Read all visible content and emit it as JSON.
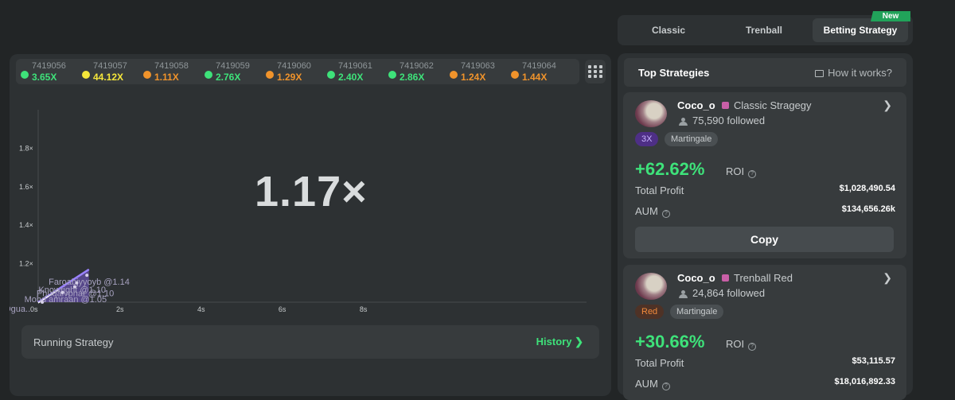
{
  "crash_history": [
    {
      "id": "7419056",
      "multiplier": "3.65X",
      "color": "#3ee27a"
    },
    {
      "id": "7419057",
      "multiplier": "44.12X",
      "color": "#f5e63a"
    },
    {
      "id": "7419058",
      "multiplier": "1.11X",
      "color": "#f0932b"
    },
    {
      "id": "7419059",
      "multiplier": "2.76X",
      "color": "#3ee27a"
    },
    {
      "id": "7419060",
      "multiplier": "1.29X",
      "color": "#f0932b"
    },
    {
      "id": "7419061",
      "multiplier": "2.40X",
      "color": "#3ee27a"
    },
    {
      "id": "7419062",
      "multiplier": "2.86X",
      "color": "#3ee27a"
    },
    {
      "id": "7419063",
      "multiplier": "1.24X",
      "color": "#f0932b"
    },
    {
      "id": "7419064",
      "multiplier": "1.44X",
      "color": "#f0932b"
    }
  ],
  "current_multiplier": "1.17×",
  "chart_data": {
    "type": "line",
    "x_ticks": [
      "0s",
      "2s",
      "4s",
      "6s",
      "8s"
    ],
    "y_ticks": [
      "1.2×",
      "1.4×",
      "1.6×",
      "1.8×"
    ],
    "xlim": [
      0,
      10
    ],
    "ylim": [
      1.0,
      2.0
    ],
    "curve": {
      "x": [
        0,
        1.25
      ],
      "y": [
        1.0,
        1.17
      ]
    },
    "cashouts": [
      {
        "label": "Faroabjyyoyb @1.14",
        "x": 1.2,
        "y": 1.14
      },
      {
        "label": "Knowright @1.10",
        "x": 0.95,
        "y": 1.1
      },
      {
        "label": "Phuqaivphar @1.10",
        "x": 0.9,
        "y": 1.08
      },
      {
        "label": "Mohd amraan @1.05",
        "x": 0.6,
        "y": 1.05
      },
      {
        "label": "Ogua...",
        "x": 0.1,
        "y": 1.0
      }
    ]
  },
  "running": {
    "label": "Running Strategy",
    "history_label": "History"
  },
  "tabs": [
    {
      "label": "Classic"
    },
    {
      "label": "Trenball"
    },
    {
      "label": "Betting Strategy",
      "active": true
    }
  ],
  "new_badge": "New",
  "top_strategies": {
    "title": "Top Strategies",
    "how_label": "How it works?"
  },
  "strategies": [
    {
      "user": "Coco_o",
      "type": "Classic Stragegy",
      "followed": "75,590 followed",
      "tags": [
        {
          "label": "3X",
          "bg": "#4e2f86",
          "color": "#c9b4ff"
        },
        {
          "label": "Martingale",
          "bg": "#4a4f52",
          "color": "#c7cbcd"
        }
      ],
      "roi": "+62.62%",
      "roi_label": "ROI",
      "profit_label": "Total Profit",
      "profit": "$1,028,490.54",
      "aum_label": "AUM",
      "aum": "$134,656.26k",
      "copy_label": "Copy"
    },
    {
      "user": "Coco_o",
      "type": "Trenball Red",
      "followed": "24,864 followed",
      "tags": [
        {
          "label": "Red",
          "bg": "#4e3226",
          "color": "#f08a3c"
        },
        {
          "label": "Martingale",
          "bg": "#4a4f52",
          "color": "#c7cbcd"
        }
      ],
      "roi": "+30.66%",
      "roi_label": "ROI",
      "profit_label": "Total Profit",
      "profit": "$53,115.57",
      "aum_label": "AUM",
      "aum": "$18,016,892.33"
    }
  ]
}
